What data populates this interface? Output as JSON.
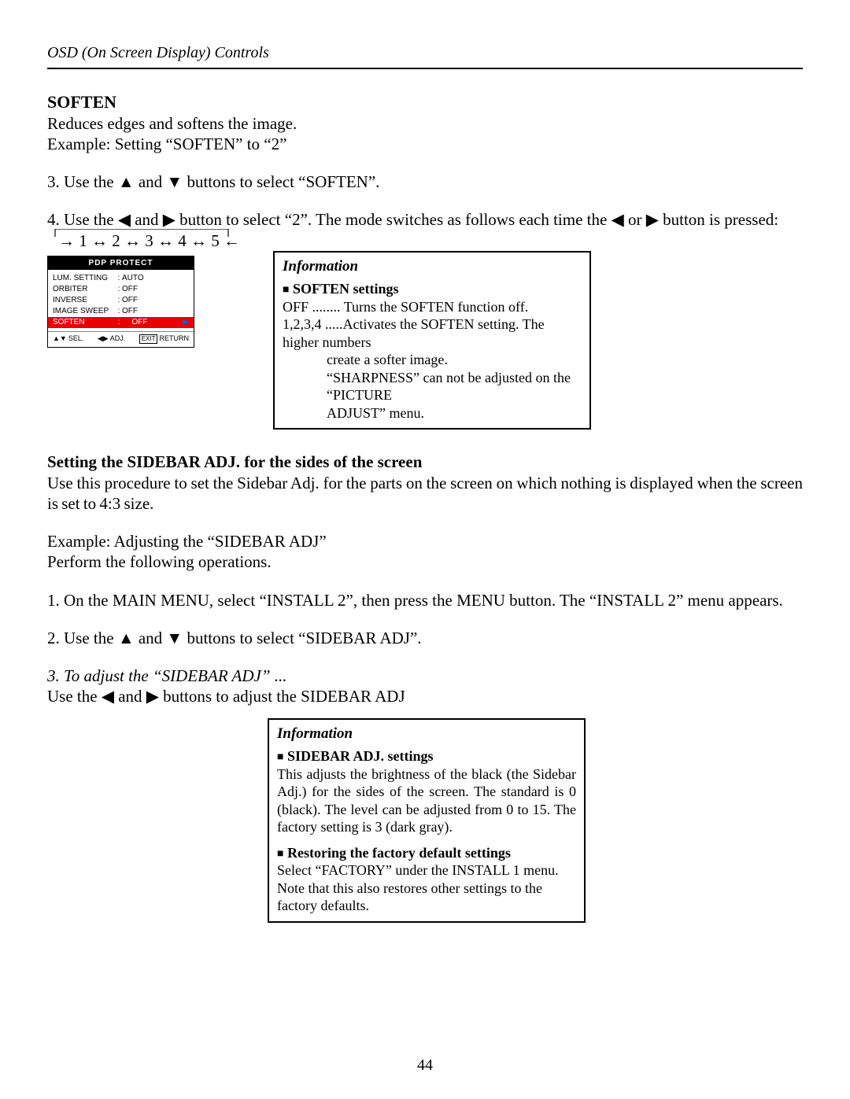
{
  "header": "OSD (On Screen Display) Controls",
  "soften": {
    "title": "SOFTEN",
    "line1": "Reduces edges and softens the image.",
    "line2": "Example: Setting “SOFTEN” to “2”",
    "step3": "3. Use the ▲ and ▼ buttons to select “SOFTEN”.",
    "step4": "4. Use the ◀ and ▶ button to select “2”.  The mode switches as follows each time the ◀ or ▶ button is pressed:",
    "cycle": "→ 1 ↔ 2 ↔ 3  ↔ 4 ↔ 5 ←"
  },
  "osd": {
    "title": "PDP PROTECT",
    "rows": [
      {
        "label": "LUM. SETTING",
        "val": "AUTO"
      },
      {
        "label": "ORBITER",
        "val": "OFF"
      },
      {
        "label": "INVERSE",
        "val": "OFF"
      },
      {
        "label": "IMAGE SWEEP",
        "val": "OFF"
      }
    ],
    "sel": {
      "label": "SOFTEN",
      "val": "OFF"
    },
    "footer": {
      "sel": "SEL.",
      "adj": "ADJ.",
      "exit": "EXIT",
      "ret": "RETURN"
    }
  },
  "info1": {
    "title": "Information",
    "sub": "SOFTEN settings",
    "l1": "OFF ........ Turns the SOFTEN function off.",
    "l2": "1,2,3,4 .....Activates the SOFTEN setting.  The higher numbers",
    "l3": "create a softer image.",
    "l4": "“SHARPNESS” can not be adjusted on the “PICTURE",
    "l5": "ADJUST” menu."
  },
  "sidebar": {
    "title": "Setting the SIDEBAR ADJ. for the sides of the screen",
    "l1": "Use this procedure to set the Sidebar Adj. for the parts on the screen on which nothing is displayed when the screen is set to 4:3 size.",
    "l2": "Example: Adjusting the “SIDEBAR ADJ”",
    "l3": "Perform the following operations.",
    "s1": "1. On the MAIN MENU, select “INSTALL 2”, then press the MENU button. The “INSTALL 2” menu appears.",
    "s2": "2. Use the ▲ and ▼ buttons to select “SIDEBAR ADJ”.",
    "s3t": "3. To adjust the “SIDEBAR ADJ” ...",
    "s3b": "Use the ◀ and ▶ buttons to adjust the SIDEBAR ADJ"
  },
  "info2": {
    "title": "Information",
    "sub1": "SIDEBAR ADJ. settings",
    "t1": "This adjusts the brightness of the black (the Sidebar Adj.) for the sides of the screen. The standard is 0 (black). The level can be adjusted from 0 to 15. The factory setting is 3 (dark gray).",
    "sub2": "Restoring the factory default settings",
    "t2a": "Select “FACTORY” under the INSTALL 1 menu.",
    "t2b": "Note that this also restores other settings to the factory defaults."
  },
  "page_number": "44"
}
